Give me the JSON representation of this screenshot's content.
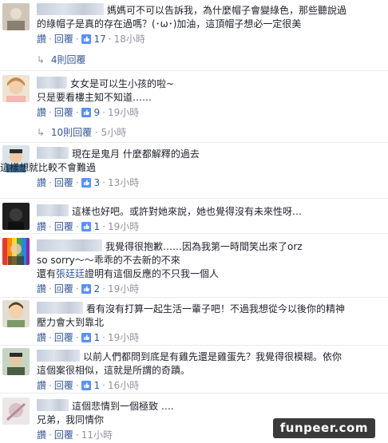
{
  "comments": [
    {
      "text_line1": "媽媽可不可以告訴我，為什麼帽子會變綠色，那些聽說過",
      "text_line2": "的綠帽子是真的存在過嗎？(･ω･)加油，這頂帽子想必一定很美",
      "reply_label": "回覆",
      "likes": "17",
      "time": "18小時",
      "replies_label": "4則回覆"
    },
    {
      "text_line1": "女女是可以生小孩的啦~",
      "text_line2": "只是要看樓主知不知道……",
      "reply_label": "回覆",
      "likes": "9",
      "time": "19小時",
      "replies_label": "10則回覆",
      "replies_time": "5小時"
    },
    {
      "text_line1": "現在是鬼月 什麼都解釋的過去",
      "text_line2": "這樣想就比較不會難過",
      "reply_label": "回覆",
      "likes": "3",
      "time": "13小時"
    },
    {
      "text_line1": "這樣也好吧。或許對她來說，她也覺得沒有未來性呀…",
      "reply_label": "回覆",
      "likes": "1",
      "time": "19小時"
    },
    {
      "text_line1": "我覺得很抱歉……因為我第一時間笑出來了orz",
      "text_line2": "so sorry～～乖乖的不去新的不來",
      "text_line3_prefix": "還有",
      "text_line3_link": "張廷廷",
      "text_line3_suffix": "證明有這個反應的不只我一個人",
      "reply_label": "回覆",
      "likes": "2",
      "time": "19小時"
    },
    {
      "text_line1": "看有沒有打算一起生活一輩子吧！不過我想從今以後你的精神",
      "text_line2": "壓力會大到靠北",
      "reply_label": "回覆",
      "likes": "1",
      "time": "19小時"
    },
    {
      "text_line1": "以前人們都問到底是有雞先還是雞蛋先？我覺得很模糊。依你",
      "text_line2": "這個案很相似，這就是所謂的奇蹟。",
      "reply_label": "回覆",
      "likes": "1",
      "time": "16小時"
    },
    {
      "text_line1": "這個悲情到一個極致 ….",
      "text_line2": "兄弟，我同情你",
      "reply_label": "回覆",
      "time": "11小時"
    }
  ],
  "like_label": "讚",
  "watermark": "funpeer.com",
  "colors": {
    "link": "#365899",
    "meta": "#90949c",
    "text": "#1d2129",
    "divider": "#e9ebee"
  }
}
